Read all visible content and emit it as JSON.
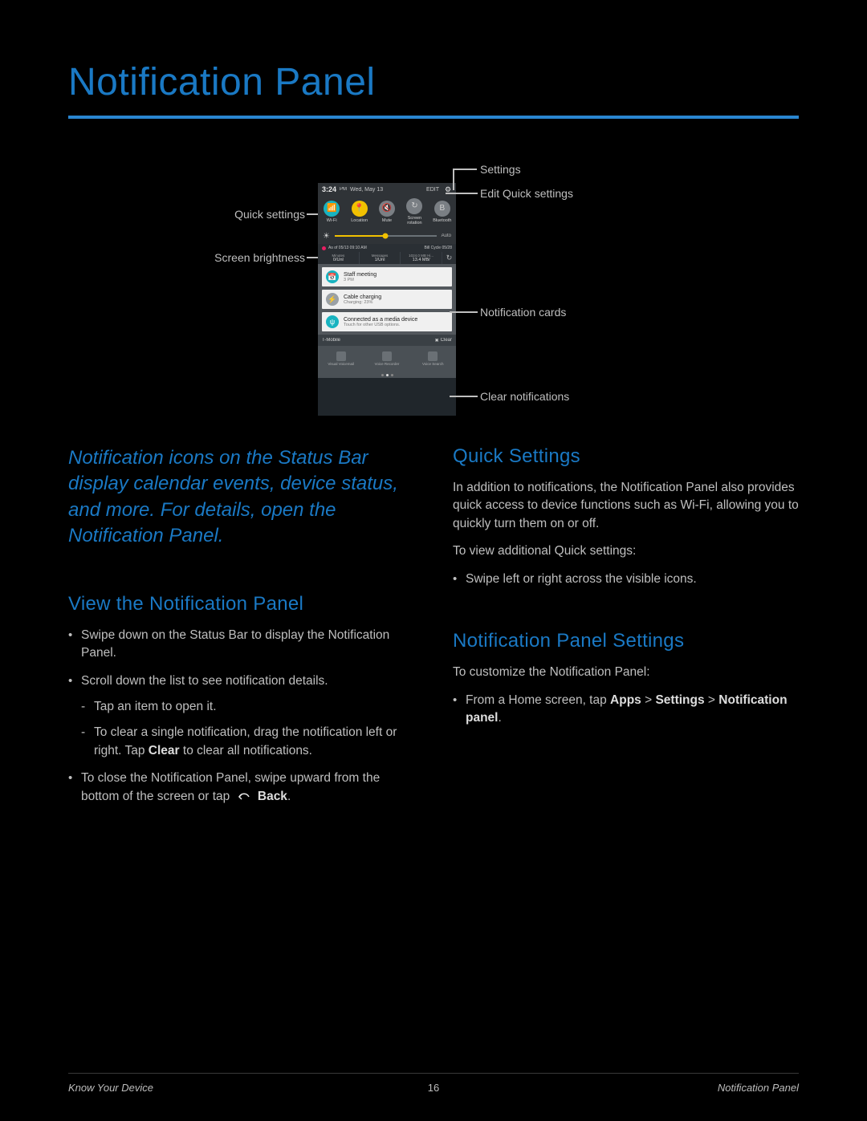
{
  "colors": {
    "blue": "#1a79c4",
    "accent": "#18b3c0",
    "warn": "#f2c100"
  },
  "title": "Notification Panel",
  "callouts": {
    "settings": "Settings",
    "qs_edit": "Edit Quick settings",
    "notif_cards": "Notification cards",
    "clear": "Clear notifications",
    "qs": "Quick settings",
    "brightness": "Screen brightness"
  },
  "phone": {
    "time": "3:24",
    "ampm": "PM",
    "date": "Wed, May 13",
    "edit": "EDIT",
    "qs": [
      {
        "label": "Wi-Fi",
        "state": "on",
        "glyph": "📶"
      },
      {
        "label": "Location",
        "state": "loc",
        "glyph": "📍"
      },
      {
        "label": "Mute",
        "state": "off",
        "glyph": "🔇"
      },
      {
        "label": "Screen\nrotation",
        "state": "off",
        "glyph": "↻"
      },
      {
        "label": "Bluetooth",
        "state": "off",
        "glyph": "B"
      }
    ],
    "brightness": {
      "percent": 50,
      "auto": "Auto"
    },
    "carrier_info": {
      "asof": "As of 05/13 09:10 AM",
      "cycle": "Bill Cycle 05/28",
      "cells": [
        {
          "h": "Minutes",
          "v": "0/Unl"
        },
        {
          "h": "Messages",
          "v": "1/Unl"
        },
        {
          "h": "1024.0 MB Hi...",
          "v": "13.4 MB/"
        }
      ]
    },
    "notifications": [
      {
        "icon": "calendar",
        "iconGlyph": "📅",
        "title": "Staff meeting",
        "sub": "3 PM"
      },
      {
        "icon": "charging",
        "iconGlyph": "⚡",
        "title": "Cable charging",
        "sub": "Charging: 23%",
        "iconClass": "gray"
      },
      {
        "icon": "usb",
        "iconGlyph": "ψ",
        "title": "Connected as a media device",
        "sub": "Touch for other USB options."
      }
    ],
    "carrier": "T-Mobile",
    "clear": "Clear",
    "apps": [
      "Visual Voicemail",
      "Voice Recorder",
      "Voice Search"
    ]
  },
  "left_col": {
    "lead": "Notification icons on the Status Bar display calendar events, device status, and more. For details, open the Notification Panel.",
    "view_h": "View the Notification Panel",
    "view_p1": "Swipe down on the Status Bar to display the Notification Panel.",
    "view_b1": "Scroll down the list to see notification details.",
    "view_b1a": "Tap an item to open it.",
    "view_b1b_pre": "To clear a single notification, drag the notification left or right. Tap ",
    "view_b1b_key": "Clear",
    "view_b1b_post": " to clear all notifications.",
    "view_b2_pre": "To close the Notification Panel, swipe upward from the bottom of the screen or tap ",
    "view_b2_key": "Back",
    "view_b2_post": "."
  },
  "right_col": {
    "qs_h": "Quick Settings",
    "qs_p1": "In addition to notifications, the Notification Panel also provides quick access to device functions such as Wi-Fi, allowing you to quickly turn them on or off.",
    "qs_p2": "To view additional Quick settings:",
    "qs_b1": "Swipe left or right across the visible icons.",
    "nps_h": "Notification Panel Settings",
    "nps_p": "To customize the Notification Panel:",
    "nps_b1_pre": "From a Home screen, tap ",
    "nps_b1_key1": "Apps",
    "nps_b1_mid": " > ",
    "nps_b1_key2": "Settings",
    "nps_b1_mid2": " > ",
    "nps_b1_key3": "Notification panel",
    "nps_b1_post": "."
  },
  "footer": {
    "left": "Know Your Device",
    "center": "16",
    "right": "Notification Panel"
  }
}
